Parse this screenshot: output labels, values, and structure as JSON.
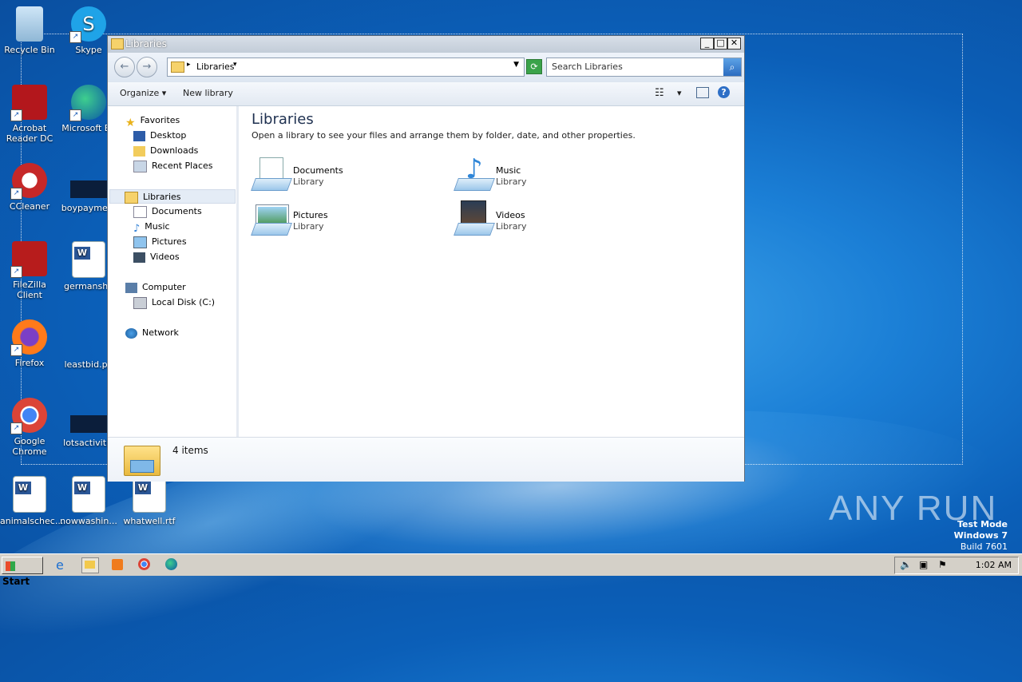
{
  "desktop": {
    "icons": [
      {
        "label": "Recycle Bin"
      },
      {
        "label": "Skype"
      },
      {
        "label": "Acrobat Reader DC"
      },
      {
        "label": "Microsoft Ed"
      },
      {
        "label": "CCleaner"
      },
      {
        "label": "boypayme..."
      },
      {
        "label": "FileZilla Client"
      },
      {
        "label": "germansho"
      },
      {
        "label": "Firefox"
      },
      {
        "label": "leastbid.pn"
      },
      {
        "label": "Google Chrome"
      },
      {
        "label": "lotsactivitie"
      },
      {
        "label": "animalschec..."
      },
      {
        "label": "nowwashin..."
      },
      {
        "label": "whatwell.rtf"
      }
    ]
  },
  "window": {
    "title": "Libraries",
    "address": "Libraries",
    "search_placeholder": "Search Libraries",
    "toolbar": {
      "organize": "Organize",
      "new_library": "New library"
    },
    "nav": {
      "favorites": "Favorites",
      "desktop": "Desktop",
      "downloads": "Downloads",
      "recent": "Recent Places",
      "libraries": "Libraries",
      "documents": "Documents",
      "music": "Music",
      "pictures": "Pictures",
      "videos": "Videos",
      "computer": "Computer",
      "local_disk": "Local Disk (C:)",
      "network": "Network"
    },
    "content": {
      "title": "Libraries",
      "description": "Open a library to see your files and arrange them by folder, date, and other properties.",
      "items": [
        {
          "name": "Documents",
          "type": "Library"
        },
        {
          "name": "Music",
          "type": "Library"
        },
        {
          "name": "Pictures",
          "type": "Library"
        },
        {
          "name": "Videos",
          "type": "Library"
        }
      ]
    },
    "details": {
      "count": "4 items"
    }
  },
  "taskbar": {
    "start": "Start",
    "clock": "1:02 AM"
  },
  "watermark": {
    "line1": "Test Mode",
    "line2": "Windows 7",
    "line3": "Build 7601",
    "brand": "ANY RUN"
  }
}
